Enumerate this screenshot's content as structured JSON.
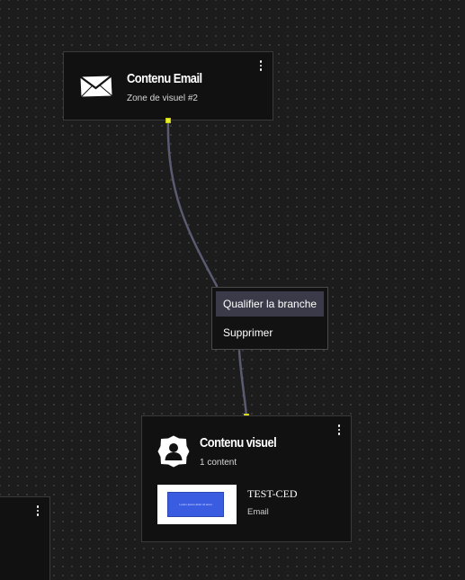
{
  "nodes": {
    "email": {
      "title": "Contenu Email",
      "subtitle": "Zone de visuel #2",
      "icon": "envelope-icon"
    },
    "visuel": {
      "title": "Contenu visuel",
      "subtitle": "1 content",
      "icon": "user-badge-icon",
      "items": [
        {
          "title": "TEST-CED",
          "type": "Email",
          "thumbnail_text": "Lorem ipsum dolor sit amet"
        }
      ]
    },
    "partial": {
      "icon": "more-vertical-icon"
    }
  },
  "context_menu": {
    "items": [
      {
        "label": "Qualifier la branche",
        "active": true
      },
      {
        "label": "Supprimer",
        "active": false
      }
    ]
  },
  "colors": {
    "canvas": "#1c1c1c",
    "node_bg": "#111111",
    "node_border": "#3a3a3a",
    "edge": "#5a5a70",
    "port": "#e9f02a",
    "menu_highlight": "#3a3a48",
    "thumbnail_accent": "#3a5ce0"
  }
}
